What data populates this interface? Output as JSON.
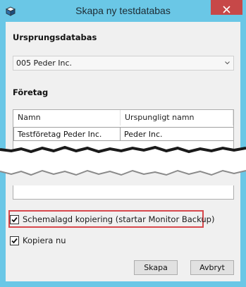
{
  "window": {
    "title": "Skapa ny testdatabas"
  },
  "source_db": {
    "label": "Ursprungsdatabas",
    "selected": "005 Peder Inc."
  },
  "company": {
    "label": "Företag",
    "columns": [
      "Namn",
      "Urspungligt namn"
    ],
    "rows": [
      {
        "name": "Testföretag Peder Inc.",
        "original": "Peder Inc."
      }
    ]
  },
  "options": {
    "scheduled_copy": {
      "label": "Schemalagd kopiering (startar Monitor Backup)",
      "checked": true
    },
    "copy_now": {
      "label": "Kopiera nu",
      "checked": true
    }
  },
  "buttons": {
    "create": "Skapa",
    "cancel": "Avbryt"
  },
  "colors": {
    "titlebar": "#6ac7e6",
    "close": "#c74848",
    "highlight": "#d7484c"
  }
}
